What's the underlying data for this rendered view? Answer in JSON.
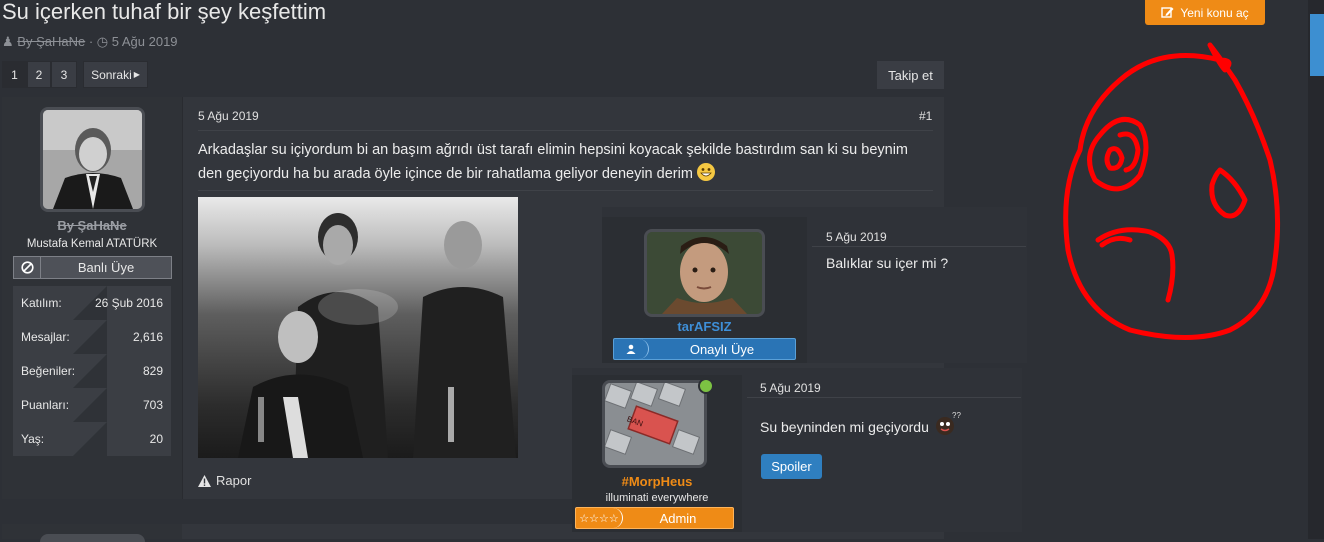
{
  "thread": {
    "title": "Su içerken tuhaf bir şey keşfettim",
    "author": "By ŞaHaNe",
    "date": "5 Ağu 2019"
  },
  "header": {
    "new_thread_label": "Yeni konu aç"
  },
  "pagination": {
    "pages": [
      "1",
      "2",
      "3"
    ],
    "next_label": "Sonraki",
    "follow_label": "Takip et"
  },
  "post": {
    "date": "5 Ağu 2019",
    "number": "#1",
    "author": {
      "name": "By ŞaHaNe",
      "title": "Mustafa Kemal ATATÜRK",
      "banner": "Banlı Üye"
    },
    "stats": [
      {
        "label": "Katılım:",
        "value": "26 Şub 2016"
      },
      {
        "label": "Mesajlar:",
        "value": "2,616"
      },
      {
        "label": "Beğeniler:",
        "value": "829"
      },
      {
        "label": "Puanları:",
        "value": "703"
      },
      {
        "label": "Yaş:",
        "value": "20"
      }
    ],
    "text": "Arkadaşlar su içiyordum bi an başım ağrıdı üst tarafı elimin hepsini koyacak şekilde bastırdım san ki su beynim den geçiyordu ha bu arada öyle içince de bir rahatlama geliyor deneyin derim",
    "report_label": "Rapor"
  },
  "reply1": {
    "date": "5 Ağu 2019",
    "text": "Balıklar su içer mi ?",
    "author": {
      "name": "tarAFSIZ",
      "banner": "Onaylı Üye"
    }
  },
  "reply2": {
    "date": "5 Ağu 2019",
    "text": "Su beyninden mi geçiyordu",
    "author": {
      "name": "#MorpHeus",
      "title": "illuminati everywhere",
      "banner": "Admin",
      "stars": "☆☆☆☆"
    },
    "spoiler_label": "Spoiler",
    "keyboard_key_text": "BAN"
  },
  "colors": {
    "accent_orange": "#ef8b16",
    "accent_blue": "#2f7fc0",
    "doodle_red": "#ff0000"
  }
}
